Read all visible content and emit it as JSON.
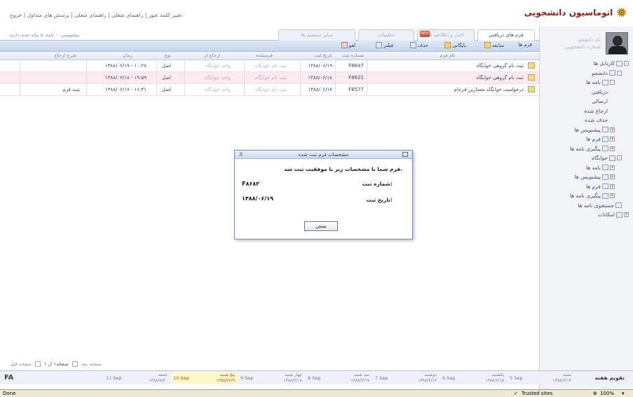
{
  "header": {
    "logo_text": "اتوماسیون دانشجویی",
    "top_links": "تغییر کلمه عبور | راهنمای شغلی | راهنمای شغلی | پرسش های متداول | خروج"
  },
  "sidebar": {
    "user_name": "نام دانشجو",
    "user_id": "شماره دانشجویی",
    "tree": [
      {
        "label": "کارتابل ها",
        "level": 0,
        "expand": "-"
      },
      {
        "label": "دانشجو",
        "level": 1,
        "expand": "-"
      },
      {
        "label": "نامه ها",
        "level": 2,
        "expand": "-"
      },
      {
        "label": "دریافتی",
        "level": 3,
        "expand": ""
      },
      {
        "label": "ارسالی",
        "level": 3,
        "expand": ""
      },
      {
        "label": "ارجاع شده",
        "level": 3,
        "expand": ""
      },
      {
        "label": "حذف شده",
        "level": 3,
        "expand": ""
      },
      {
        "label": "پیشنویس ها",
        "level": 2,
        "expand": "+"
      },
      {
        "label": "فرم ها",
        "level": 2,
        "expand": "+"
      },
      {
        "label": "پیگیری نامه ها",
        "level": 2,
        "expand": "+"
      },
      {
        "label": "خوابگاه",
        "level": 1,
        "expand": "-"
      },
      {
        "label": "نامه ها",
        "level": 2,
        "expand": "+"
      },
      {
        "label": "پیشنویس ها",
        "level": 2,
        "expand": "+"
      },
      {
        "label": "فرم ها",
        "level": 2,
        "expand": "+"
      },
      {
        "label": "پیگیری نامه ها",
        "level": 2,
        "expand": "+"
      },
      {
        "label": "جستجوی نامه ها",
        "level": 1,
        "expand": ""
      },
      {
        "label": "امکانات",
        "level": 0,
        "expand": "+"
      }
    ]
  },
  "tabs": {
    "received_forms": "فرم های دریافتی",
    "news": "اخبار و اطلاعیه ها",
    "settings": "تنظیمات",
    "other_systems": "سایر سیستم ها"
  },
  "warning_text": "پیشنویس، ۰ نامه، ۵ پیام جدید دارید",
  "toolbar": {
    "forms": "فرم ها",
    "history": "سابقه",
    "archive": "بایگانی",
    "delete": "حذف",
    "filter": "فیلتر",
    "cancel": "لغو"
  },
  "table": {
    "columns": [
      "نام فرم",
      "شماره ثبت",
      "تاریخ ثبت",
      "فرستنده",
      "ارجاع از",
      "نوع",
      "زمان",
      "شرح ارجاع"
    ],
    "rows": [
      {
        "name": "ثبت نام گروهی خوابگاه",
        "number": "F8647",
        "date": "۱۳۸۸/۰۶/۱۹",
        "sender": "ثبت نام خوابگاه",
        "ref_from": "واحد خوابگاه",
        "type": "اصل",
        "time": "۱۳۸۸/۰۶/۱۹ - ۱۰:۲۸",
        "desc": ""
      },
      {
        "name": "ثبت نام گروهی خوابگاه",
        "number": "F8621",
        "date": "۱۳۸۸/۰۶/۱۸",
        "sender": "ثبت نام خوابگاه",
        "ref_from": "واحد خوابگاه",
        "type": "اصل",
        "time": "۱۳۸۸/۰۶/۱۸ - ۱۹:۵۹",
        "desc": ""
      },
      {
        "name": "درخواست خوابگاه معمارین-فرجام",
        "number": "F8577",
        "date": "۱۳۸۸/۰۶/۱۷",
        "sender": "ثبت نام خوابگاه",
        "ref_from": "واحد خوابگاه",
        "type": "اصل",
        "time": "۱۳۸۸/۰۶/۱۷ - ۱۶:۴۱",
        "desc": "ثبت فرم"
      }
    ]
  },
  "pager": {
    "next": "صفحه بعد",
    "info": "صفحه۱ از ۱",
    "prev": "صفحه قبل"
  },
  "dialog": {
    "title": "مشخصات فرم ثبت شده",
    "message": "فرم شما با مشخصات زیر با موفقیت ثبت شد.",
    "reg_number_label": "شماره ثبت:",
    "reg_number_value": "F۸۶۸۲",
    "reg_date_label": "تاریخ ثبت:",
    "reg_date_value": "۱۳۸۸/۰۶/۱۹",
    "close_button": "بستن",
    "close_glyph": "X"
  },
  "calendar": {
    "title": "تقویم هفته",
    "lang": "FA",
    "days": [
      {
        "fa_name": "شنبه",
        "fa_date": "۱۳۸۸/۶/۱۴",
        "en": "5 Sep"
      },
      {
        "fa_name": "یکشنبه",
        "fa_date": "۱۳۸۸/۶/۱۵",
        "en": "6 Sep"
      },
      {
        "fa_name": "دوشنبه",
        "fa_date": "۱۳۸۸/۶/۱۶",
        "en": "7 Sep"
      },
      {
        "fa_name": "سه شنبه",
        "fa_date": "۱۳۸۸/۶/۱۷",
        "en": "8 Sep"
      },
      {
        "fa_name": "چهار شنبه",
        "fa_date": "۱۳۸۸/۶/۱۸",
        "en": "9 Sep"
      },
      {
        "fa_name": "پنج شنبه",
        "fa_date": "۱۳۸۸/۶/۱۹",
        "en": "10 Sep"
      },
      {
        "fa_name": "جمعه",
        "fa_date": "۱۳۸۸/۶/۲۰",
        "en": "11 Sep"
      }
    ]
  },
  "statusbar": {
    "left": "Done",
    "zone": "Trusted sites",
    "zoom": "100%"
  },
  "colors": {
    "brand": "#8a1f18",
    "highlight_row": "#fde9f0",
    "today": "#fff7cc"
  }
}
